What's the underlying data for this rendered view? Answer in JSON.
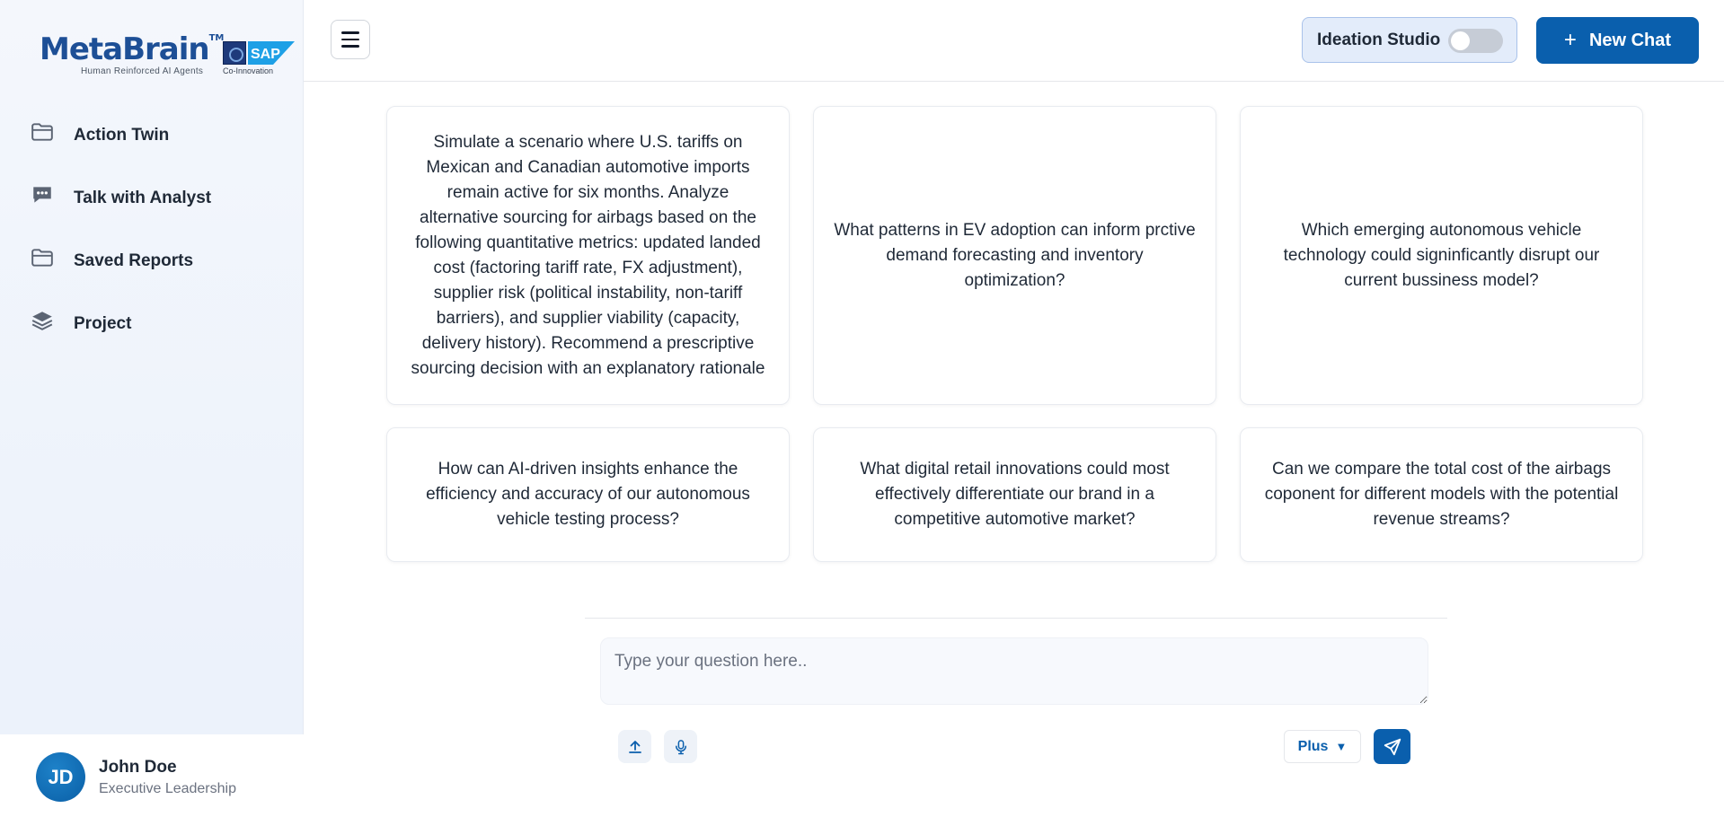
{
  "brand": {
    "name": "MetaBrain",
    "trademark": "TM",
    "tagline": "Human Reinforced AI Agents",
    "partner_logo_text": "SAP",
    "partner_caption": "Co-Innovation",
    "colors": {
      "primary": "#0a5fad",
      "brand_text": "#1d4f96",
      "sap_blue": "#1ea0e6"
    }
  },
  "sidebar": {
    "items": [
      {
        "label": "Action Twin",
        "icon": "folder-icon"
      },
      {
        "label": "Talk with Analyst",
        "icon": "chat-bubble-icon"
      },
      {
        "label": "Saved Reports",
        "icon": "folder-icon"
      },
      {
        "label": "Project",
        "icon": "layers-icon"
      }
    ],
    "profile": {
      "initials": "JD",
      "name": "John Doe",
      "role": "Executive Leadership"
    }
  },
  "header": {
    "menu_icon": "hamburger-menu-icon",
    "ideation_studio_label": "Ideation Studio",
    "ideation_studio_enabled": false,
    "new_chat_label": "New Chat"
  },
  "suggestions": [
    "Simulate a scenario where U.S. tariffs on Mexican and Canadian automotive imports remain active for six months. Analyze alternative sourcing for airbags based on the following quantitative metrics: updated landed cost (factoring tariff rate, FX adjustment), supplier risk (political instability, non-tariff barriers), and supplier viability (capacity, delivery history). Recommend a prescriptive sourcing decision with an explanatory rationale",
    "What patterns in EV adoption can inform prctive demand forecasting and inventory optimization?",
    "Which emerging autonomous vehicle technology could signinficantly disrupt our current bussiness model?",
    "How can AI-driven insights enhance the efficiency and accuracy of our autonomous vehicle testing process?",
    "What digital retail innovations could most effectively differentiate our brand in a competitive automotive market?",
    "Can we compare the total cost of the airbags coponent for different models with the potential revenue streams?"
  ],
  "composer": {
    "placeholder": "Type your question here..",
    "value": "",
    "upload_icon": "upload-icon",
    "mic_icon": "microphone-icon",
    "mode_selected": "Plus",
    "send_icon": "send-icon"
  }
}
